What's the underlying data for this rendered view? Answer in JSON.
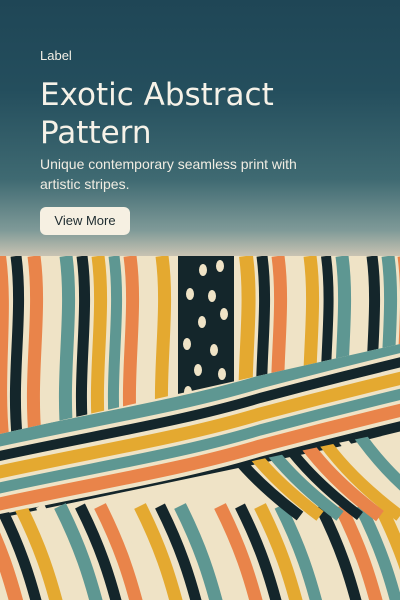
{
  "card": {
    "label": "Label",
    "title": "Exotic Abstract Pattern",
    "description": "Unique contemporary seamless print with artistic stripes.",
    "button_label": "View More"
  },
  "artwork": {
    "name": "abstract-stripe-pattern",
    "colors": {
      "cream": "#efe3c6",
      "teal": "#5e9792",
      "dark": "#14262b",
      "orange": "#e9844a",
      "mustard": "#e4a930",
      "navy": "#1c3d4b"
    }
  }
}
